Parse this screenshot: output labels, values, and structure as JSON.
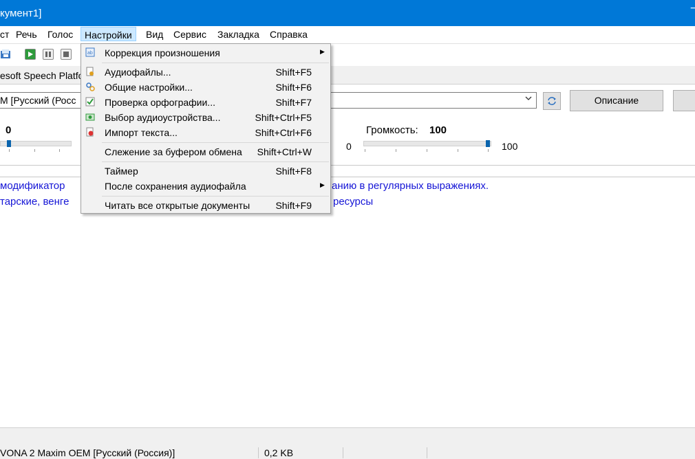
{
  "window": {
    "title": "кумент1]",
    "minimize_glyph": "−"
  },
  "menubar": {
    "items": [
      "ст",
      "Речь",
      "Голос",
      "Настройки",
      "Вид",
      "Сервис",
      "Закладка",
      "Справка"
    ],
    "active_index": 3
  },
  "toolbar": {
    "buttons": [
      "open-icon",
      "play-icon",
      "pause-icon",
      "stop-icon"
    ]
  },
  "engine": {
    "label": "esoft Speech Platfo"
  },
  "voice": {
    "selected": "M [Русский (Росс"
  },
  "describe_button": "Описание",
  "rate": {
    "value": "0",
    "level": 0
  },
  "volume": {
    "label": "Громкость:",
    "value": "100",
    "min": "0",
    "max": "100",
    "level": 1.0
  },
  "document": {
    "lines": [
      {
        "left": " модификатор",
        "right": "анию в регулярных выражениях."
      },
      {
        "left": "тарские, венге",
        "right": "ресурсы"
      }
    ]
  },
  "statusbar": {
    "voice": "VONA 2 Maxim OEM [Русский (Россия)]",
    "size": "0,2 KB"
  },
  "dropdown": {
    "items": [
      {
        "label": "Коррекция произношения",
        "shortcut": "",
        "submenu": true,
        "icon": "pronunciation-icon"
      },
      {
        "label": "Аудиофайлы...",
        "shortcut": "Shift+F5",
        "submenu": false,
        "icon": "audio-files-icon"
      },
      {
        "label": "Общие настройки...",
        "shortcut": "Shift+F6",
        "submenu": false,
        "icon": "settings-icon"
      },
      {
        "label": "Проверка орфографии...",
        "shortcut": "Shift+F7",
        "submenu": false,
        "icon": "spellcheck-icon"
      },
      {
        "label": "Выбор аудиоустройства...",
        "shortcut": "Shift+Ctrl+F5",
        "submenu": false,
        "icon": "audio-device-icon"
      },
      {
        "label": "Импорт текста...",
        "shortcut": "Shift+Ctrl+F6",
        "submenu": false,
        "icon": "import-text-icon"
      },
      {
        "label": "Слежение за буфером обмена",
        "shortcut": "Shift+Ctrl+W",
        "submenu": false,
        "icon": ""
      },
      {
        "label": "Таймер",
        "shortcut": "Shift+F8",
        "submenu": false,
        "icon": ""
      },
      {
        "label": "После сохранения аудиофайла",
        "shortcut": "",
        "submenu": true,
        "icon": ""
      },
      {
        "label": "Читать все открытые документы",
        "shortcut": "Shift+F9",
        "submenu": false,
        "icon": ""
      }
    ]
  }
}
